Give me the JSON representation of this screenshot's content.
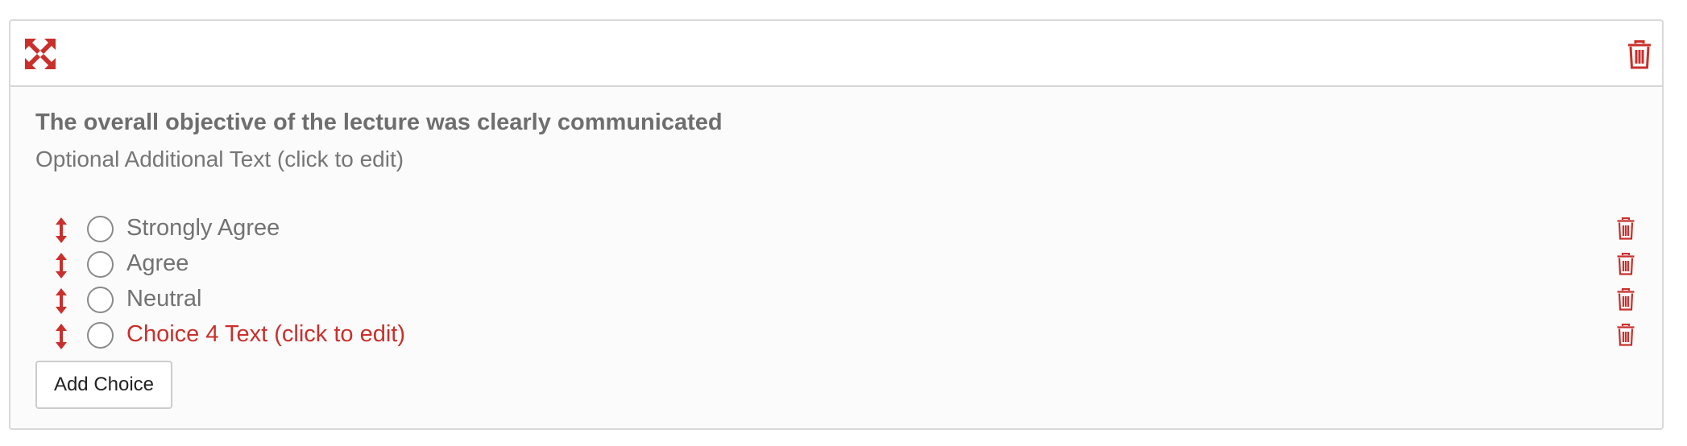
{
  "colors": {
    "accent": "#c9302c",
    "text_muted": "#727272",
    "border": "#d9d9d9"
  },
  "header": {
    "move_icon": "move-arrows-icon",
    "delete_icon": "trash-icon"
  },
  "question": {
    "title": "The overall objective of the lecture was clearly communicated",
    "additional_text": "Optional Additional Text (click to edit)"
  },
  "choices": [
    {
      "label": "Strongly Agree",
      "is_placeholder": false
    },
    {
      "label": "Agree",
      "is_placeholder": false
    },
    {
      "label": "Neutral",
      "is_placeholder": false
    },
    {
      "label": "Choice 4 Text (click to edit)",
      "is_placeholder": true
    }
  ],
  "actions": {
    "add_choice_label": "Add Choice"
  }
}
